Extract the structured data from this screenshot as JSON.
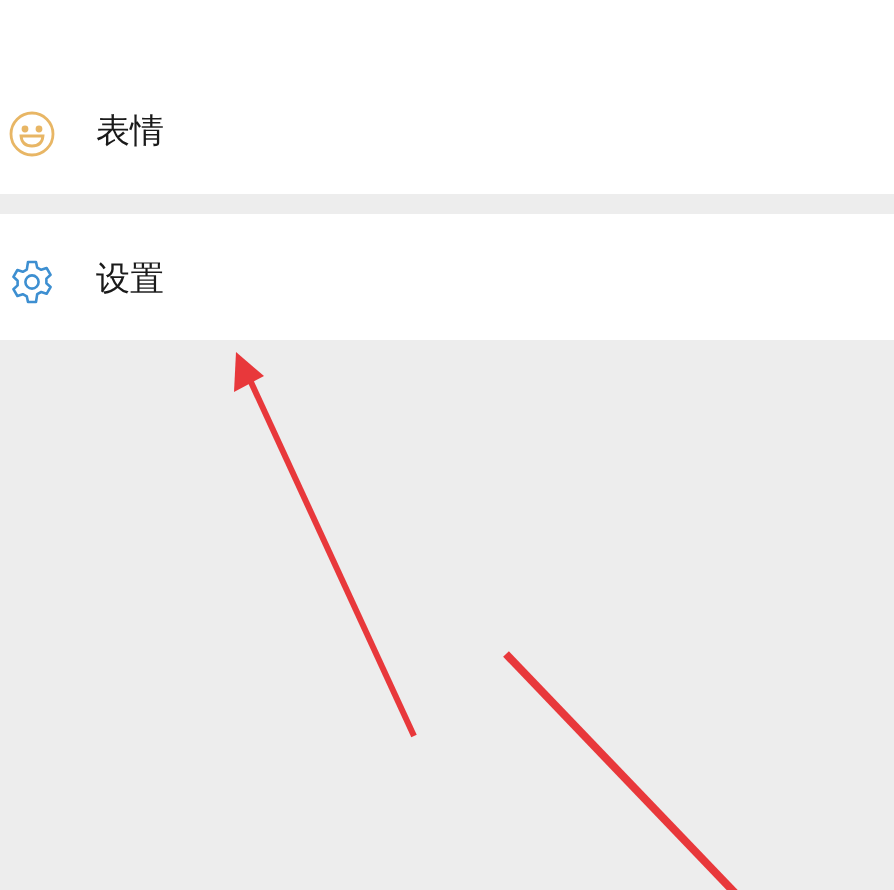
{
  "menu_items": [
    {
      "kind": "sticker",
      "label": "表情"
    },
    {
      "kind": "settings",
      "label": "设置"
    }
  ]
}
